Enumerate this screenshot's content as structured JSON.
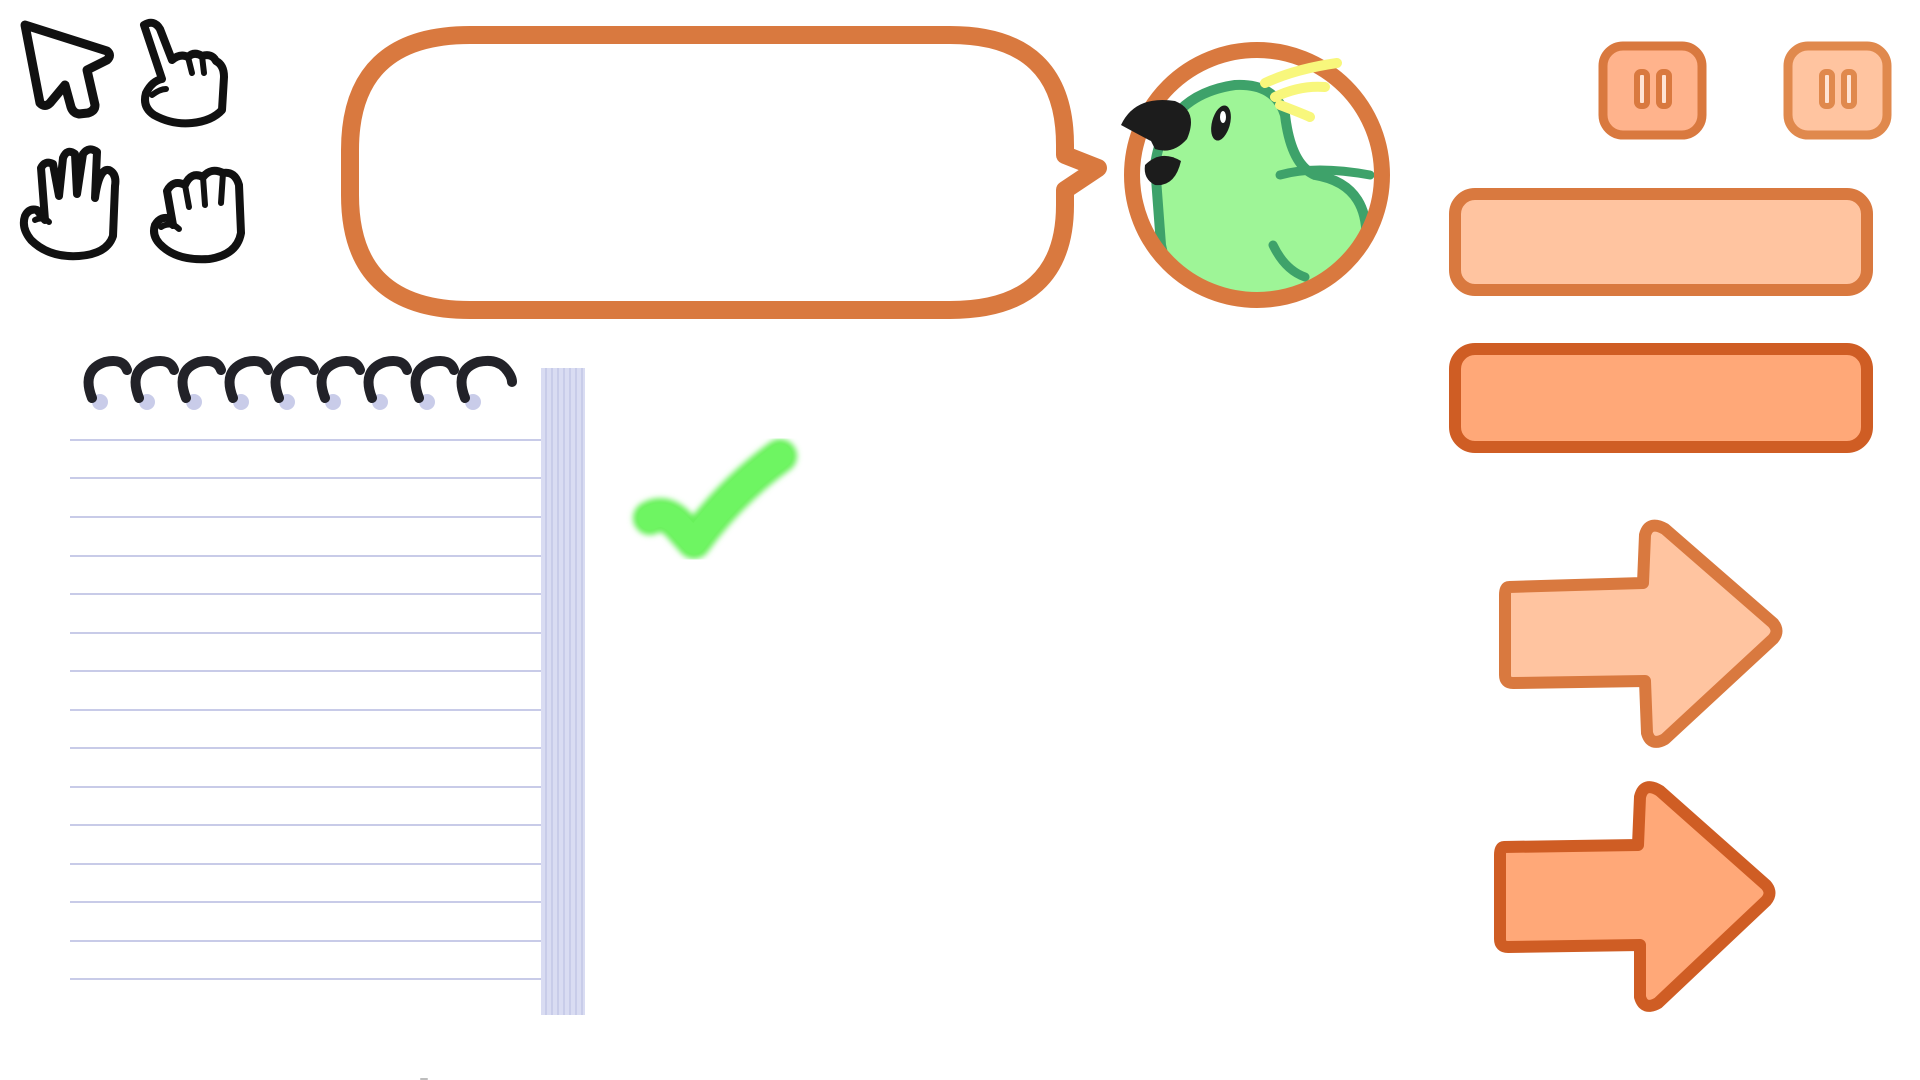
{
  "bubble": {
    "text": ""
  },
  "colors": {
    "orange_outline": "#d9793f",
    "orange_fill_light": "#ffc4a0",
    "orange_outline_dark": "#cf5d24",
    "orange_fill_dark": "#ffa878",
    "ink": "#111111",
    "parrot_green": "#9ef597",
    "parrot_dark_green": "#3ea26a",
    "parrot_crest": "#f8f77c",
    "check_green": "#68f15a",
    "notebook_line": "#c8cbe8",
    "spiral_ink": "#222228",
    "notebook_edge": "#c9cce9"
  },
  "icons": {
    "cursors": [
      "arrow-cursor-icon",
      "pointing-hand-icon",
      "open-hand-icon",
      "grab-hand-icon"
    ],
    "portrait": "parrot-icon",
    "pause": "pause-icon",
    "arrow": "right-arrow-icon",
    "check": "checkmark-icon",
    "notepad": "spiral-notepad-icon"
  }
}
